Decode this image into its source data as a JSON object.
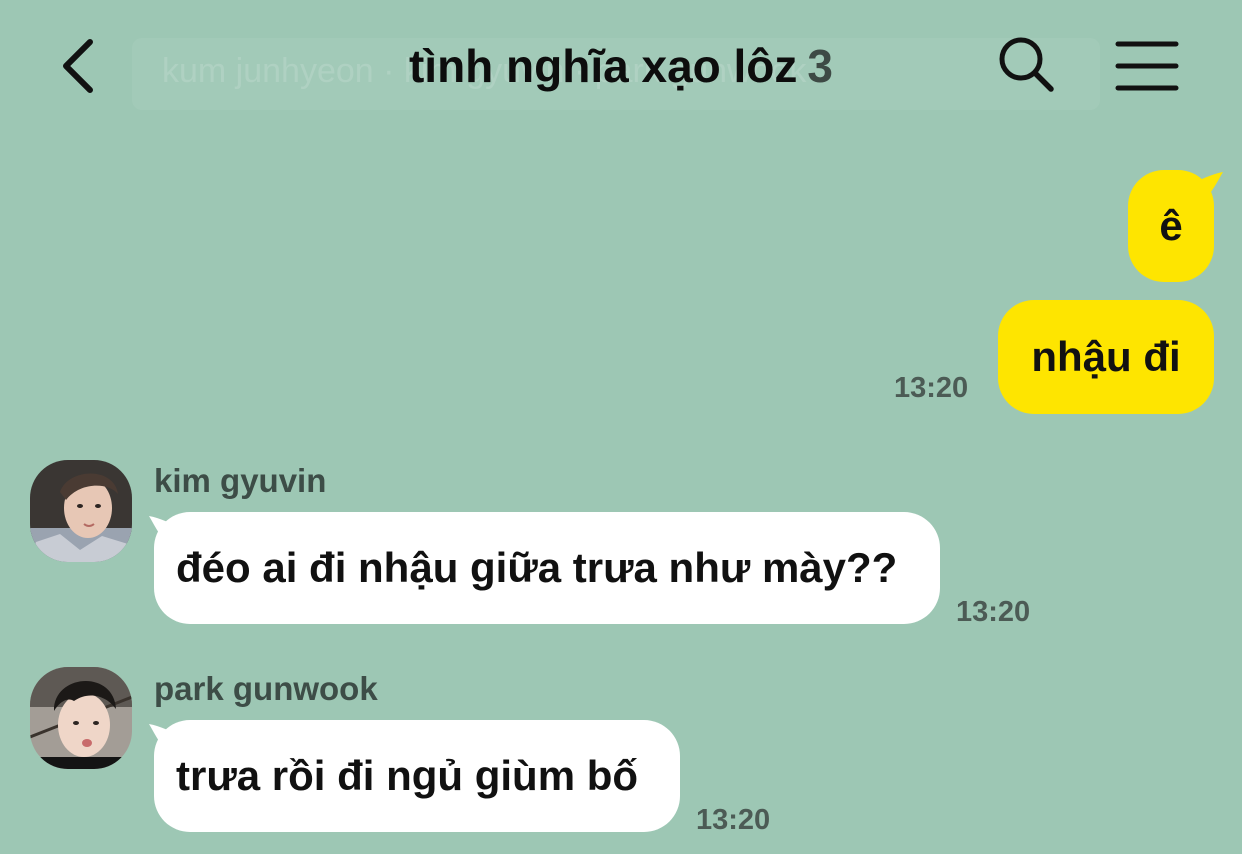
{
  "header": {
    "title": "tình nghĩa xạo lôz",
    "member_count": "3",
    "ghost_members": "kum junhyeon · kim gyuvin · park gunwook"
  },
  "colors": {
    "background": "#9dc7b4",
    "my_bubble": "#fee500",
    "other_bubble": "#ffffff"
  },
  "icons": {
    "back": "chevron-left",
    "search": "magnifier",
    "menu": "hamburger"
  },
  "messages": [
    {
      "sender": "me",
      "text": "ê",
      "time": ""
    },
    {
      "sender": "me",
      "text": "nhậu đi",
      "time": "13:20"
    },
    {
      "sender": "kim gyuvin",
      "text": "đéo ai đi nhậu giữa trưa như mày??",
      "time": "13:20"
    },
    {
      "sender": "park gunwook",
      "text": "trưa rồi đi ngủ giùm bố",
      "time": "13:20"
    }
  ]
}
